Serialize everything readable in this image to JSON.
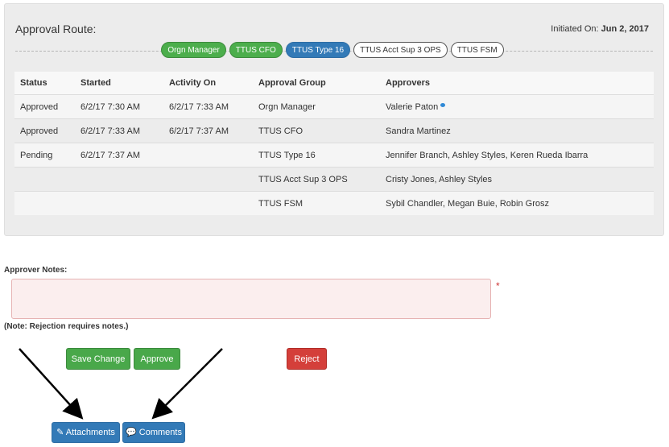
{
  "approval": {
    "title": "Approval Route:",
    "initiated_label": "Initiated On:",
    "initiated_date": "Jun 2, 2017",
    "steps": [
      {
        "label": "Orgn Manager",
        "state": "done"
      },
      {
        "label": "TTUS CFO",
        "state": "done"
      },
      {
        "label": "TTUS Type 16",
        "state": "current"
      },
      {
        "label": "TTUS Acct Sup 3 OPS",
        "state": "pending"
      },
      {
        "label": "TTUS FSM",
        "state": "pending"
      }
    ],
    "columns": [
      "Status",
      "Started",
      "Activity On",
      "Approval Group",
      "Approvers"
    ],
    "rows": [
      [
        "Approved",
        "6/2/17 7:30 AM",
        "6/2/17 7:33 AM",
        "Orgn Manager",
        "Valerie Paton"
      ],
      [
        "Approved",
        "6/2/17 7:33 AM",
        "6/2/17 7:37 AM",
        "TTUS CFO",
        "Sandra Martinez"
      ],
      [
        "Pending",
        "6/2/17 7:37 AM",
        "",
        "TTUS Type 16",
        "Jennifer Branch, Ashley Styles, Keren Rueda Ibarra"
      ],
      [
        "",
        "",
        "",
        "TTUS Acct Sup 3 OPS",
        "Cristy Jones, Ashley Styles"
      ],
      [
        "",
        "",
        "",
        "TTUS FSM",
        "Sybil Chandler, Megan Buie, Robin Grosz"
      ]
    ]
  },
  "notes": {
    "label": "Approver Notes:",
    "value": "",
    "required_mark": "*",
    "hint": "(Note: Rejection requires notes.)"
  },
  "actions": {
    "save_label": "Save Change",
    "approve_label": "Approve",
    "reject_label": "Reject",
    "attachments_label": "Attachments",
    "comments_label": "Comments"
  },
  "icons": {
    "comment_indicator": "chat-bubble-icon",
    "attachments": "paperclip-icon",
    "comments": "speech-bubble-icon"
  },
  "colors": {
    "done": "#4cae4c",
    "current": "#337ab7",
    "reject": "#d43f3a",
    "required": "#cc3333"
  }
}
